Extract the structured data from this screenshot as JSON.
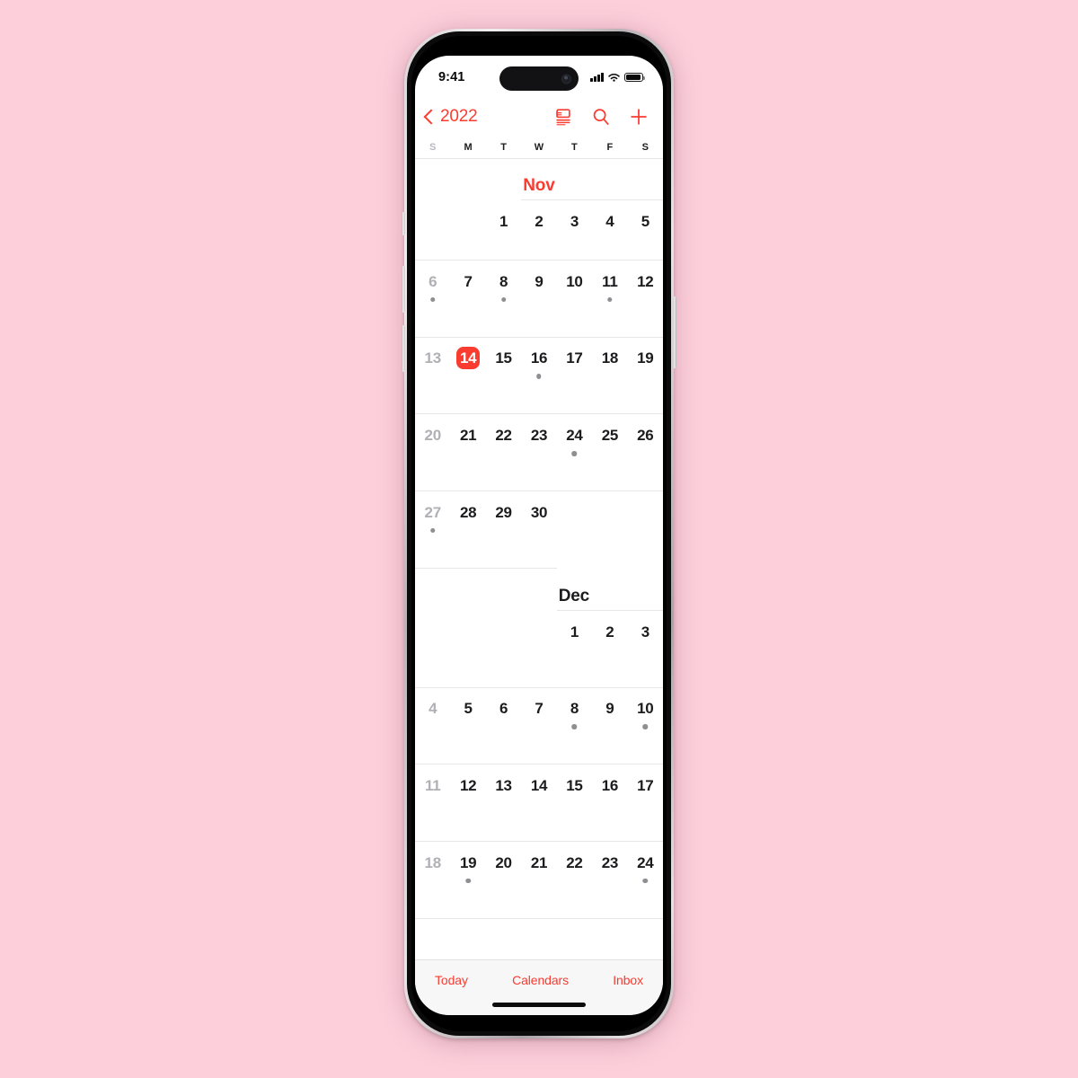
{
  "theme": {
    "page_background": "#FCCFDB",
    "accent_red": "#FA3B30",
    "screen_background": "#FFFFFF",
    "toolbar_background": "#F7F7F7",
    "dot_color": "#8E8E93",
    "dim_text": "#B0B0B5"
  },
  "status_bar": {
    "time": "9:41",
    "signal_icon": "cellular-signal-icon",
    "wifi_icon": "wifi-icon",
    "battery_icon": "battery-icon"
  },
  "nav_bar": {
    "back_icon": "chevron-left-icon",
    "back_label": "2022",
    "actions": [
      {
        "name": "day-view-icon",
        "label": "Day View"
      },
      {
        "name": "search-icon",
        "label": "Search"
      },
      {
        "name": "plus-icon",
        "label": "Add Event"
      }
    ]
  },
  "weekday_header": {
    "labels": [
      "S",
      "M",
      "T",
      "W",
      "T",
      "F",
      "S"
    ],
    "dim_indices": [
      0
    ]
  },
  "months": [
    {
      "name": "Nov",
      "is_current": true,
      "title_column": 3,
      "weeks": [
        {
          "days": [
            {
              "num": "",
              "empty": true
            },
            {
              "num": "",
              "empty": true
            },
            {
              "num": "1",
              "weekend": false,
              "dot": false
            },
            {
              "num": "2",
              "weekend": false,
              "dot": false
            },
            {
              "num": "3",
              "weekend": false,
              "dot": false
            },
            {
              "num": "4",
              "weekend": false,
              "dot": false
            },
            {
              "num": "5",
              "weekend": false,
              "dot": false
            }
          ]
        },
        {
          "days": [
            {
              "num": "6",
              "weekend": true,
              "dot": true
            },
            {
              "num": "7",
              "weekend": false,
              "dot": false
            },
            {
              "num": "8",
              "weekend": false,
              "dot": true
            },
            {
              "num": "9",
              "weekend": false,
              "dot": false
            },
            {
              "num": "10",
              "weekend": false,
              "dot": false
            },
            {
              "num": "11",
              "weekend": false,
              "dot": true
            },
            {
              "num": "12",
              "weekend": false,
              "dot": false
            }
          ]
        },
        {
          "days": [
            {
              "num": "13",
              "weekend": true,
              "dot": false
            },
            {
              "num": "14",
              "weekend": false,
              "dot": false,
              "selected": true
            },
            {
              "num": "15",
              "weekend": false,
              "dot": false
            },
            {
              "num": "16",
              "weekend": false,
              "dot": true
            },
            {
              "num": "17",
              "weekend": false,
              "dot": false
            },
            {
              "num": "18",
              "weekend": false,
              "dot": false
            },
            {
              "num": "19",
              "weekend": false,
              "dot": false
            }
          ]
        },
        {
          "days": [
            {
              "num": "20",
              "weekend": true,
              "dot": false
            },
            {
              "num": "21",
              "weekend": false,
              "dot": false
            },
            {
              "num": "22",
              "weekend": false,
              "dot": false
            },
            {
              "num": "23",
              "weekend": false,
              "dot": false
            },
            {
              "num": "24",
              "weekend": false,
              "dot": true
            },
            {
              "num": "25",
              "weekend": false,
              "dot": false
            },
            {
              "num": "26",
              "weekend": false,
              "dot": false
            }
          ]
        },
        {
          "days": [
            {
              "num": "27",
              "weekend": true,
              "dot": true
            },
            {
              "num": "28",
              "weekend": false,
              "dot": false
            },
            {
              "num": "29",
              "weekend": false,
              "dot": false
            },
            {
              "num": "30",
              "weekend": false,
              "dot": false
            },
            {
              "num": "",
              "empty": true
            },
            {
              "num": "",
              "empty": true
            },
            {
              "num": "",
              "empty": true
            }
          ]
        }
      ]
    },
    {
      "name": "Dec",
      "is_current": false,
      "title_column": 4,
      "weeks": [
        {
          "days": [
            {
              "num": "",
              "empty": true
            },
            {
              "num": "",
              "empty": true
            },
            {
              "num": "",
              "empty": true
            },
            {
              "num": "",
              "empty": true
            },
            {
              "num": "1",
              "weekend": false,
              "dot": false
            },
            {
              "num": "2",
              "weekend": false,
              "dot": false
            },
            {
              "num": "3",
              "weekend": false,
              "dot": false
            }
          ]
        },
        {
          "days": [
            {
              "num": "4",
              "weekend": true,
              "dot": false
            },
            {
              "num": "5",
              "weekend": false,
              "dot": false
            },
            {
              "num": "6",
              "weekend": false,
              "dot": false
            },
            {
              "num": "7",
              "weekend": false,
              "dot": false
            },
            {
              "num": "8",
              "weekend": false,
              "dot": true
            },
            {
              "num": "9",
              "weekend": false,
              "dot": false
            },
            {
              "num": "10",
              "weekend": false,
              "dot": true
            }
          ]
        },
        {
          "days": [
            {
              "num": "11",
              "weekend": true,
              "dot": false
            },
            {
              "num": "12",
              "weekend": false,
              "dot": false
            },
            {
              "num": "13",
              "weekend": false,
              "dot": false
            },
            {
              "num": "14",
              "weekend": false,
              "dot": false
            },
            {
              "num": "15",
              "weekend": false,
              "dot": false
            },
            {
              "num": "16",
              "weekend": false,
              "dot": false
            },
            {
              "num": "17",
              "weekend": false,
              "dot": false
            }
          ]
        },
        {
          "days": [
            {
              "num": "18",
              "weekend": true,
              "dot": false
            },
            {
              "num": "19",
              "weekend": false,
              "dot": true
            },
            {
              "num": "20",
              "weekend": false,
              "dot": false
            },
            {
              "num": "21",
              "weekend": false,
              "dot": false
            },
            {
              "num": "22",
              "weekend": false,
              "dot": false
            },
            {
              "num": "23",
              "weekend": false,
              "dot": false
            },
            {
              "num": "24",
              "weekend": false,
              "dot": true
            }
          ]
        }
      ]
    }
  ],
  "toolbar": {
    "today_label": "Today",
    "calendars_label": "Calendars",
    "inbox_label": "Inbox"
  }
}
